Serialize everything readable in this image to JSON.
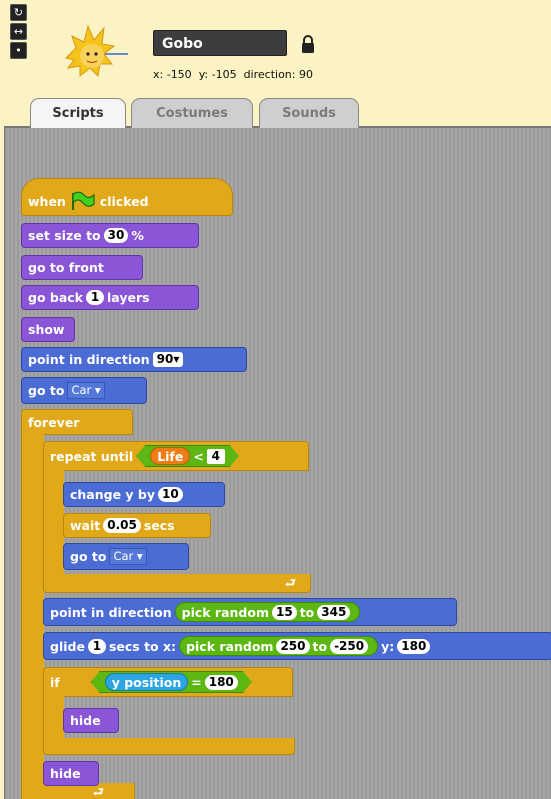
{
  "sprite": {
    "name": "Gobo",
    "x_label": "x:",
    "x": "-150",
    "y_label": "y:",
    "y": "-105",
    "direction_label": "direction:",
    "direction": "90"
  },
  "tabs": [
    {
      "label": "Scripts"
    },
    {
      "label": "Costumes"
    },
    {
      "label": "Sounds"
    }
  ],
  "rotation_style_buttons": [
    {
      "glyph": "↻"
    },
    {
      "glyph": "↔"
    },
    {
      "glyph": "•"
    }
  ],
  "colors": {
    "motion": "#4a6cd4",
    "looks": "#8a55d7",
    "control": "#e1a91a",
    "operators": "#5cb712",
    "sensing": "#2ca5e2",
    "variables": "#ee7d16"
  },
  "script": {
    "hat": {
      "label_when": "when",
      "label_clicked": "clicked",
      "icon": "green-flag-icon"
    },
    "set_size": {
      "label": "set size to",
      "value": "30",
      "unit": "%"
    },
    "go_front": {
      "label": "go to front"
    },
    "go_back": {
      "label": "go back",
      "value": "1",
      "unit": "layers"
    },
    "show": {
      "label": "show"
    },
    "point_dir": {
      "label": "point in direction",
      "value": "90"
    },
    "go_to": {
      "label": "go to",
      "target": "Car"
    },
    "forever": {
      "label": "forever"
    },
    "repeat_until": {
      "label": "repeat until",
      "var": "Life",
      "op": "<",
      "value": "4"
    },
    "change_y": {
      "label": "change y by",
      "value": "10"
    },
    "wait": {
      "label": "wait",
      "value": "0.05",
      "unit": "secs"
    },
    "go_to2": {
      "label": "go to",
      "target": "Car"
    },
    "point_dir2": {
      "label": "point in direction",
      "pick_label": "pick random",
      "from": "15",
      "to_label": "to",
      "to": "345"
    },
    "glide": {
      "label": "glide",
      "secs": "1",
      "secs_label": "secs to x:",
      "pick_label": "pick random",
      "from": "250",
      "to_label": "to",
      "to": "-250",
      "y_label": "y:",
      "y": "180"
    },
    "if": {
      "label": "if",
      "sensor": "y position",
      "op": "=",
      "value": "180"
    },
    "hide1": {
      "label": "hide"
    },
    "hide2": {
      "label": "hide"
    }
  }
}
